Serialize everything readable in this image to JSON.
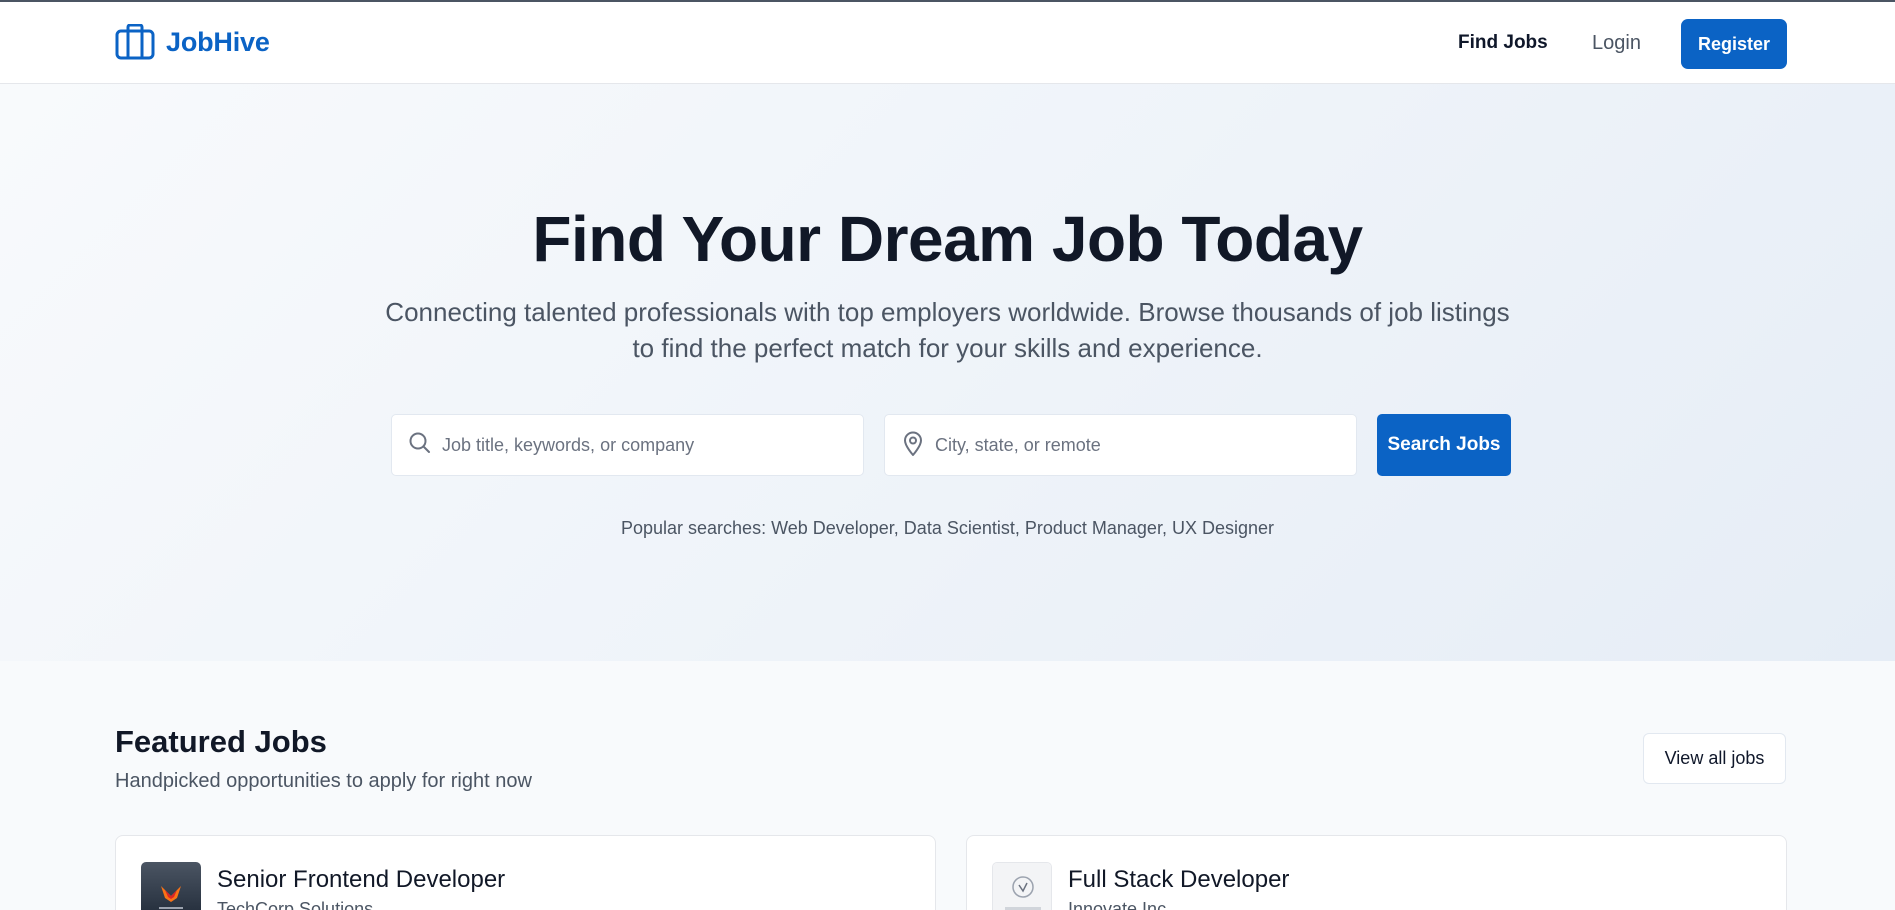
{
  "brand": {
    "name": "JobHive",
    "color": "#0b63c5"
  },
  "nav": {
    "find_jobs": "Find Jobs",
    "login": "Login",
    "register": "Register"
  },
  "hero": {
    "title": "Find Your Dream Job Today",
    "subtitle": "Connecting talented professionals with top employers worldwide. Browse thousands of job listings to find the perfect match for your skills and experience.",
    "search": {
      "what_placeholder": "Job title, keywords, or company",
      "what_value": "",
      "where_placeholder": "City, state, or remote",
      "where_value": "",
      "button": "Search Jobs"
    },
    "popular": "Popular searches: Web Developer, Data Scientist, Product Manager, UX Designer"
  },
  "featured": {
    "title": "Featured Jobs",
    "subtitle": "Handpicked opportunities to apply for right now",
    "view_all": "View all jobs",
    "jobs": [
      {
        "title": "Senior Frontend Developer",
        "company": "TechCorp Solutions",
        "logo_icon": "company-logo-dark"
      },
      {
        "title": "Full Stack Developer",
        "company": "Innovate Inc",
        "logo_icon": "company-logo-light"
      }
    ]
  }
}
